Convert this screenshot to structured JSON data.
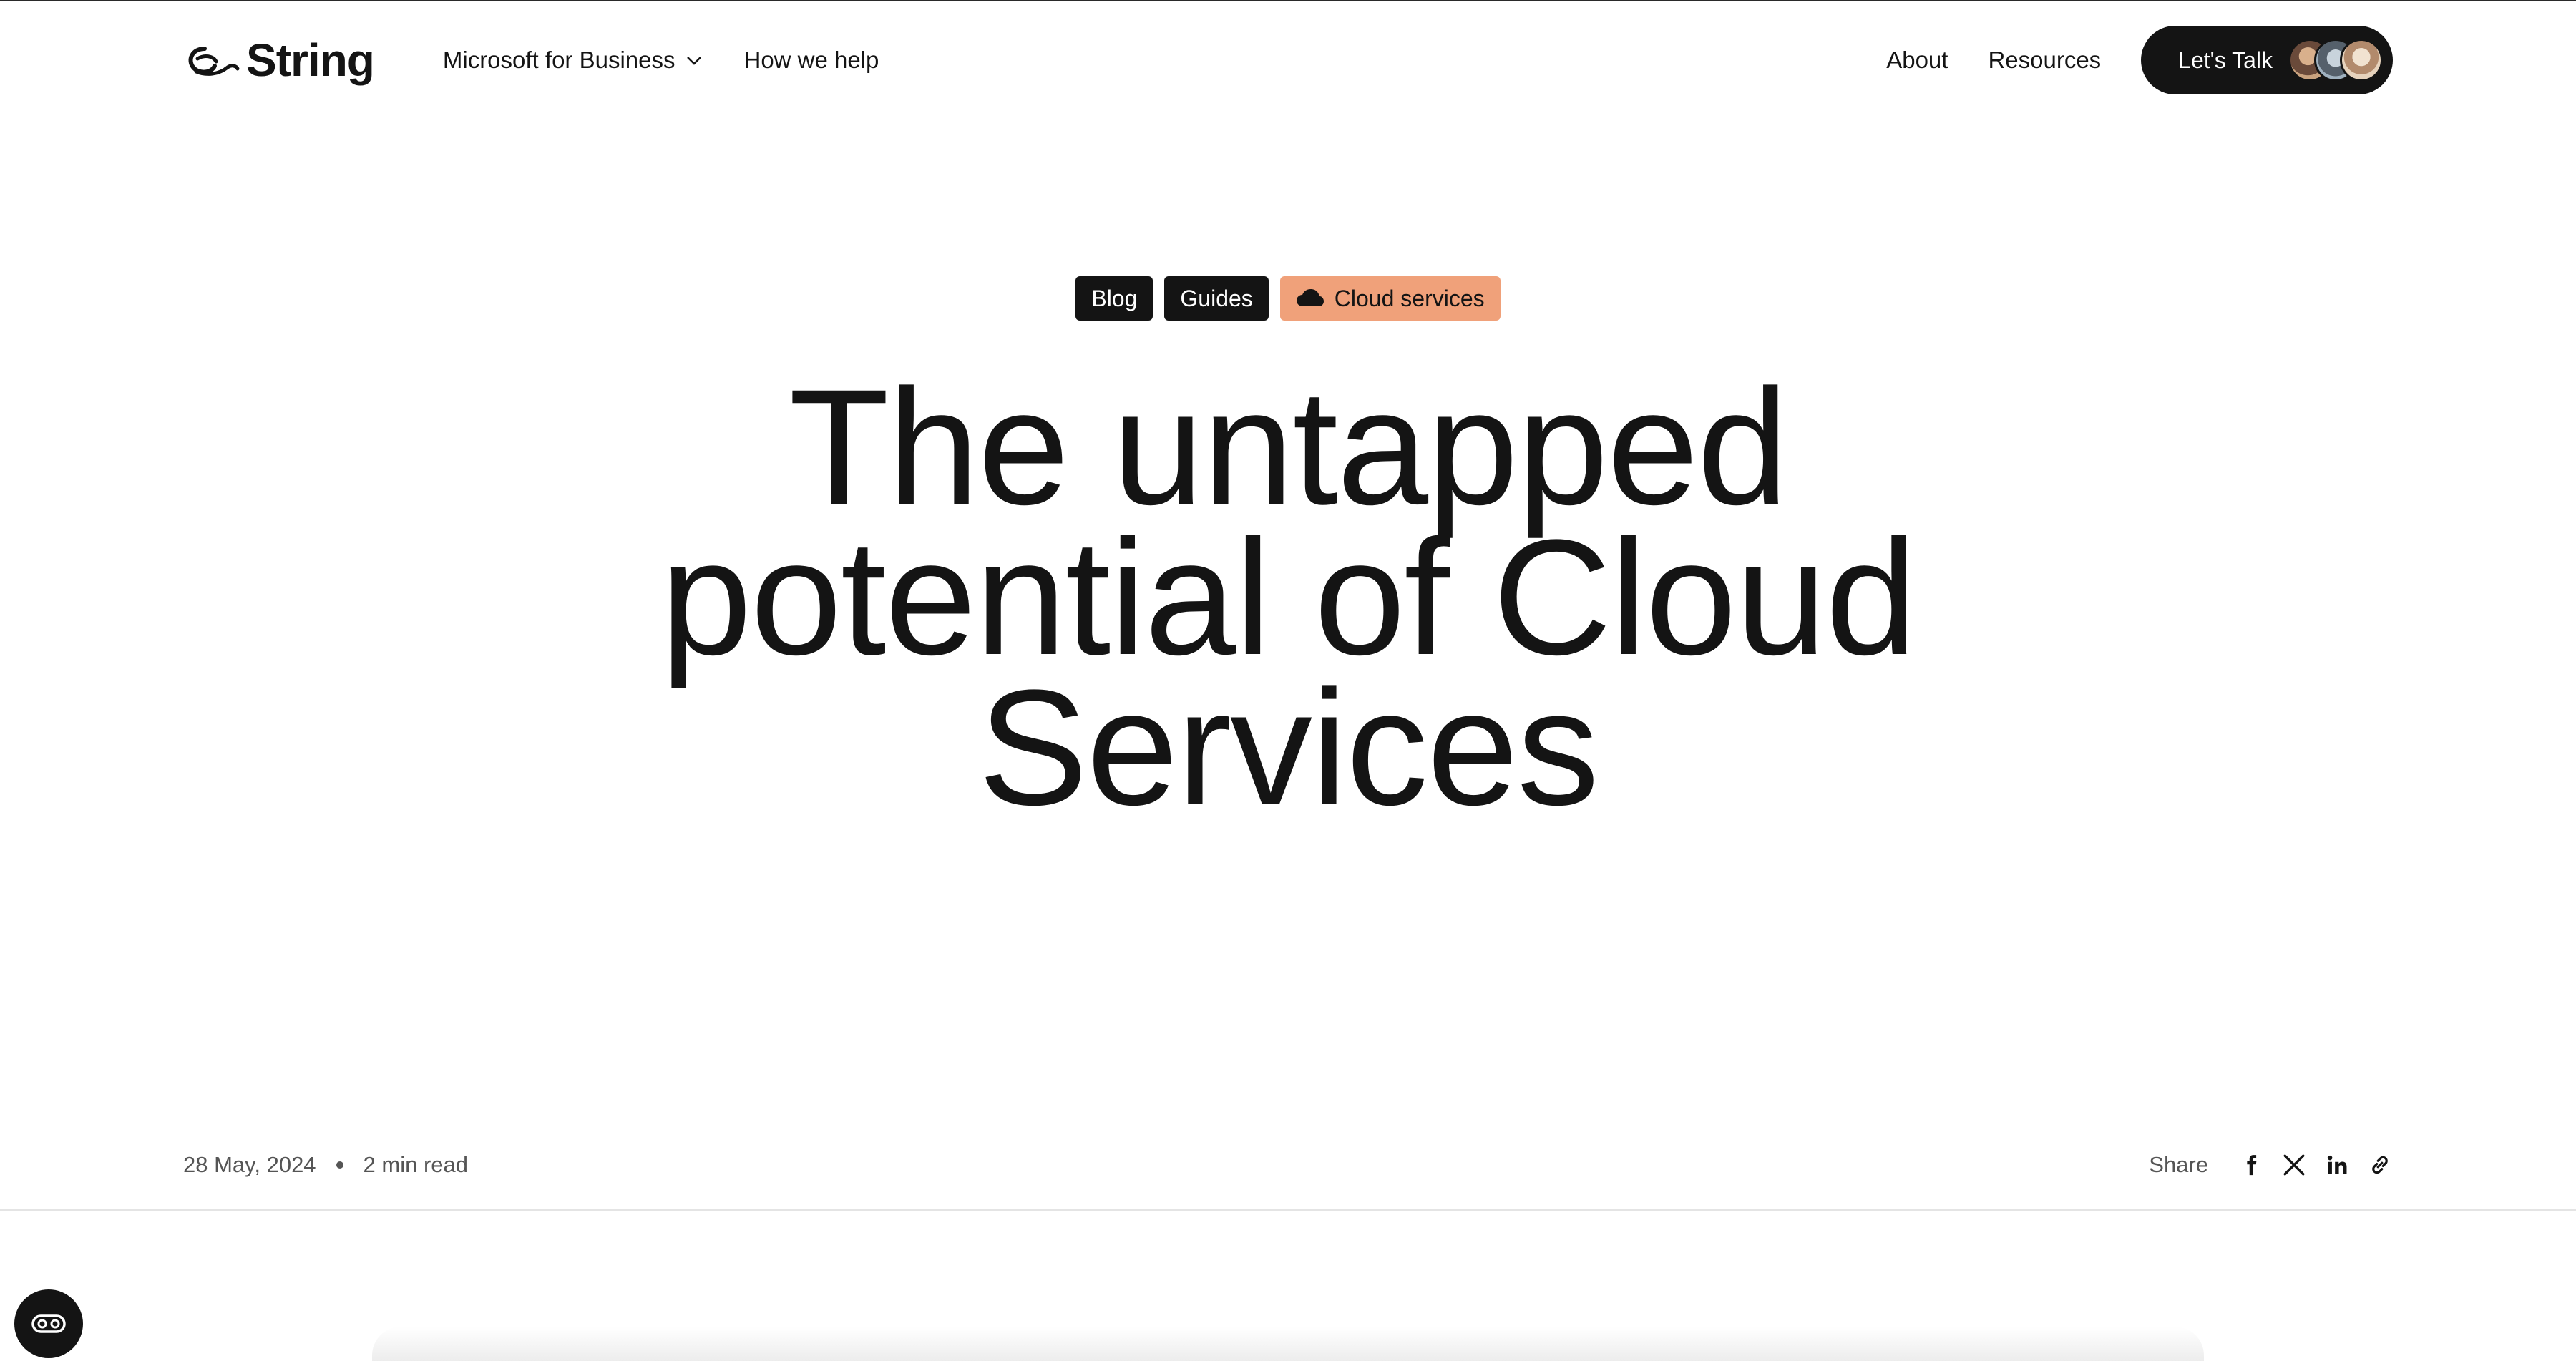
{
  "header": {
    "logo_text": "String",
    "nav_left": [
      {
        "label": "Microsoft for Business"
      },
      {
        "label": "How we help"
      }
    ],
    "nav_right": [
      {
        "label": "About"
      },
      {
        "label": "Resources"
      }
    ],
    "cta_label": "Let's Talk"
  },
  "tags": [
    {
      "label": "Blog"
    },
    {
      "label": "Guides"
    },
    {
      "label": "Cloud services",
      "icon": "cloud-icon"
    }
  ],
  "article": {
    "title_lines": [
      "The untapped",
      "potential of Cloud",
      "Services"
    ],
    "date": "28 May, 2024",
    "read_time": "2 min read"
  },
  "share": {
    "label": "Share",
    "icons": [
      "facebook-icon",
      "x-icon",
      "linkedin-icon",
      "link-icon"
    ]
  },
  "colors": {
    "primary": "#141414",
    "accent_tag": "#f0a17a",
    "muted_text": "#555555",
    "divider": "#e4e4e4"
  }
}
